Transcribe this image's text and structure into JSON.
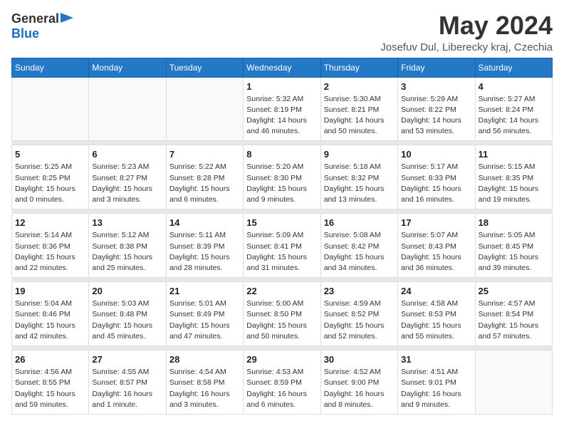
{
  "logo": {
    "general": "General",
    "blue": "Blue"
  },
  "header": {
    "month_year": "May 2024",
    "location": "Josefuv Dul, Liberecky kraj, Czechia"
  },
  "weekdays": [
    "Sunday",
    "Monday",
    "Tuesday",
    "Wednesday",
    "Thursday",
    "Friday",
    "Saturday"
  ],
  "weeks": [
    [
      {
        "day": "",
        "sunrise": "",
        "sunset": "",
        "daylight": ""
      },
      {
        "day": "",
        "sunrise": "",
        "sunset": "",
        "daylight": ""
      },
      {
        "day": "",
        "sunrise": "",
        "sunset": "",
        "daylight": ""
      },
      {
        "day": "1",
        "sunrise": "Sunrise: 5:32 AM",
        "sunset": "Sunset: 8:19 PM",
        "daylight": "Daylight: 14 hours and 46 minutes."
      },
      {
        "day": "2",
        "sunrise": "Sunrise: 5:30 AM",
        "sunset": "Sunset: 8:21 PM",
        "daylight": "Daylight: 14 hours and 50 minutes."
      },
      {
        "day": "3",
        "sunrise": "Sunrise: 5:29 AM",
        "sunset": "Sunset: 8:22 PM",
        "daylight": "Daylight: 14 hours and 53 minutes."
      },
      {
        "day": "4",
        "sunrise": "Sunrise: 5:27 AM",
        "sunset": "Sunset: 8:24 PM",
        "daylight": "Daylight: 14 hours and 56 minutes."
      }
    ],
    [
      {
        "day": "5",
        "sunrise": "Sunrise: 5:25 AM",
        "sunset": "Sunset: 8:25 PM",
        "daylight": "Daylight: 15 hours and 0 minutes."
      },
      {
        "day": "6",
        "sunrise": "Sunrise: 5:23 AM",
        "sunset": "Sunset: 8:27 PM",
        "daylight": "Daylight: 15 hours and 3 minutes."
      },
      {
        "day": "7",
        "sunrise": "Sunrise: 5:22 AM",
        "sunset": "Sunset: 8:28 PM",
        "daylight": "Daylight: 15 hours and 6 minutes."
      },
      {
        "day": "8",
        "sunrise": "Sunrise: 5:20 AM",
        "sunset": "Sunset: 8:30 PM",
        "daylight": "Daylight: 15 hours and 9 minutes."
      },
      {
        "day": "9",
        "sunrise": "Sunrise: 5:18 AM",
        "sunset": "Sunset: 8:32 PM",
        "daylight": "Daylight: 15 hours and 13 minutes."
      },
      {
        "day": "10",
        "sunrise": "Sunrise: 5:17 AM",
        "sunset": "Sunset: 8:33 PM",
        "daylight": "Daylight: 15 hours and 16 minutes."
      },
      {
        "day": "11",
        "sunrise": "Sunrise: 5:15 AM",
        "sunset": "Sunset: 8:35 PM",
        "daylight": "Daylight: 15 hours and 19 minutes."
      }
    ],
    [
      {
        "day": "12",
        "sunrise": "Sunrise: 5:14 AM",
        "sunset": "Sunset: 8:36 PM",
        "daylight": "Daylight: 15 hours and 22 minutes."
      },
      {
        "day": "13",
        "sunrise": "Sunrise: 5:12 AM",
        "sunset": "Sunset: 8:38 PM",
        "daylight": "Daylight: 15 hours and 25 minutes."
      },
      {
        "day": "14",
        "sunrise": "Sunrise: 5:11 AM",
        "sunset": "Sunset: 8:39 PM",
        "daylight": "Daylight: 15 hours and 28 minutes."
      },
      {
        "day": "15",
        "sunrise": "Sunrise: 5:09 AM",
        "sunset": "Sunset: 8:41 PM",
        "daylight": "Daylight: 15 hours and 31 minutes."
      },
      {
        "day": "16",
        "sunrise": "Sunrise: 5:08 AM",
        "sunset": "Sunset: 8:42 PM",
        "daylight": "Daylight: 15 hours and 34 minutes."
      },
      {
        "day": "17",
        "sunrise": "Sunrise: 5:07 AM",
        "sunset": "Sunset: 8:43 PM",
        "daylight": "Daylight: 15 hours and 36 minutes."
      },
      {
        "day": "18",
        "sunrise": "Sunrise: 5:05 AM",
        "sunset": "Sunset: 8:45 PM",
        "daylight": "Daylight: 15 hours and 39 minutes."
      }
    ],
    [
      {
        "day": "19",
        "sunrise": "Sunrise: 5:04 AM",
        "sunset": "Sunset: 8:46 PM",
        "daylight": "Daylight: 15 hours and 42 minutes."
      },
      {
        "day": "20",
        "sunrise": "Sunrise: 5:03 AM",
        "sunset": "Sunset: 8:48 PM",
        "daylight": "Daylight: 15 hours and 45 minutes."
      },
      {
        "day": "21",
        "sunrise": "Sunrise: 5:01 AM",
        "sunset": "Sunset: 8:49 PM",
        "daylight": "Daylight: 15 hours and 47 minutes."
      },
      {
        "day": "22",
        "sunrise": "Sunrise: 5:00 AM",
        "sunset": "Sunset: 8:50 PM",
        "daylight": "Daylight: 15 hours and 50 minutes."
      },
      {
        "day": "23",
        "sunrise": "Sunrise: 4:59 AM",
        "sunset": "Sunset: 8:52 PM",
        "daylight": "Daylight: 15 hours and 52 minutes."
      },
      {
        "day": "24",
        "sunrise": "Sunrise: 4:58 AM",
        "sunset": "Sunset: 8:53 PM",
        "daylight": "Daylight: 15 hours and 55 minutes."
      },
      {
        "day": "25",
        "sunrise": "Sunrise: 4:57 AM",
        "sunset": "Sunset: 8:54 PM",
        "daylight": "Daylight: 15 hours and 57 minutes."
      }
    ],
    [
      {
        "day": "26",
        "sunrise": "Sunrise: 4:56 AM",
        "sunset": "Sunset: 8:55 PM",
        "daylight": "Daylight: 15 hours and 59 minutes."
      },
      {
        "day": "27",
        "sunrise": "Sunrise: 4:55 AM",
        "sunset": "Sunset: 8:57 PM",
        "daylight": "Daylight: 16 hours and 1 minute."
      },
      {
        "day": "28",
        "sunrise": "Sunrise: 4:54 AM",
        "sunset": "Sunset: 8:58 PM",
        "daylight": "Daylight: 16 hours and 3 minutes."
      },
      {
        "day": "29",
        "sunrise": "Sunrise: 4:53 AM",
        "sunset": "Sunset: 8:59 PM",
        "daylight": "Daylight: 16 hours and 6 minutes."
      },
      {
        "day": "30",
        "sunrise": "Sunrise: 4:52 AM",
        "sunset": "Sunset: 9:00 PM",
        "daylight": "Daylight: 16 hours and 8 minutes."
      },
      {
        "day": "31",
        "sunrise": "Sunrise: 4:51 AM",
        "sunset": "Sunset: 9:01 PM",
        "daylight": "Daylight: 16 hours and 9 minutes."
      },
      {
        "day": "",
        "sunrise": "",
        "sunset": "",
        "daylight": ""
      }
    ]
  ]
}
